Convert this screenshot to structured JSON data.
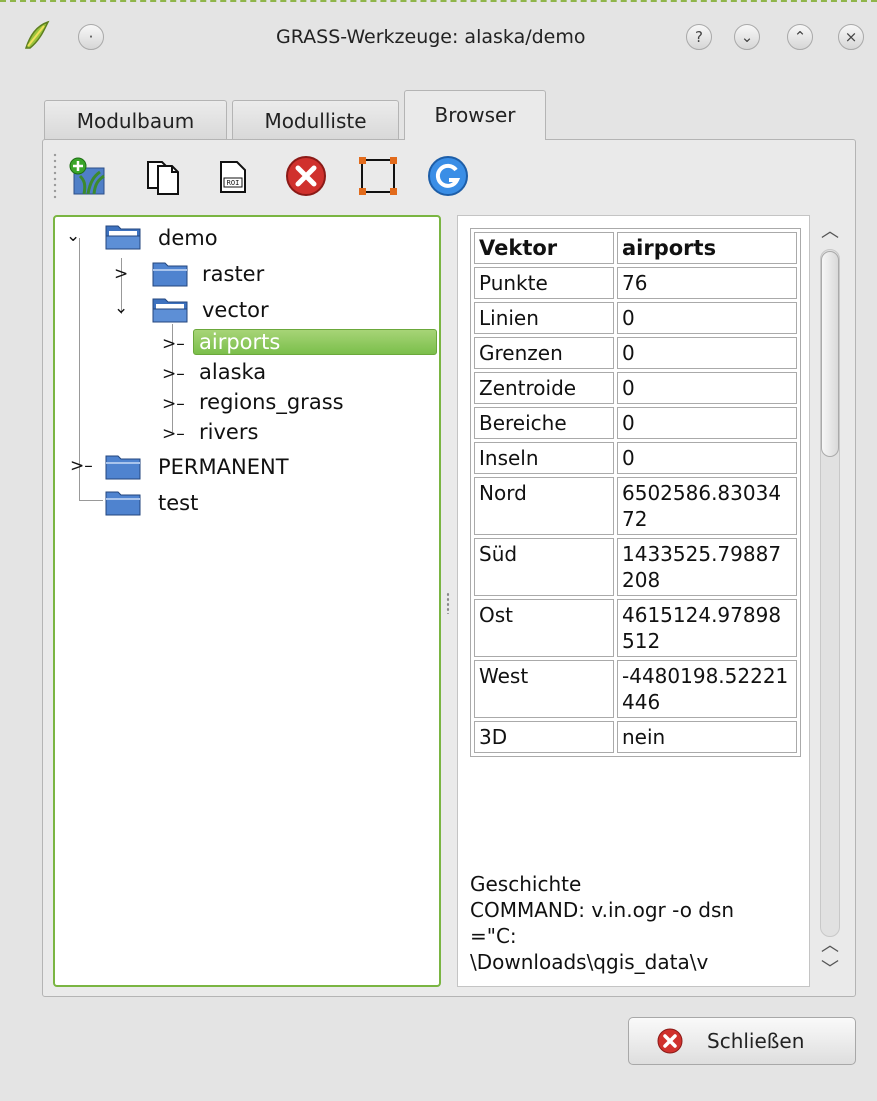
{
  "window": {
    "title": "GRASS-Werkzeuge: alaska/demo"
  },
  "titlebar_buttons": {
    "help": "?",
    "minimize": "⌄",
    "maximize": "⌃",
    "close": "×"
  },
  "tabs": [
    {
      "label": "Modulbaum",
      "active": false
    },
    {
      "label": "Modulliste",
      "active": false
    },
    {
      "label": "Browser",
      "active": true
    }
  ],
  "toolbar": {
    "icons": [
      "add-map-icon",
      "copy-icon",
      "rename-icon",
      "delete-icon",
      "set-region-icon",
      "refresh-icon"
    ]
  },
  "tree": {
    "items": [
      {
        "label": "demo",
        "level": 0,
        "expanded": true
      },
      {
        "label": "raster",
        "level": 1,
        "expanded": false
      },
      {
        "label": "vector",
        "level": 1,
        "expanded": true
      },
      {
        "label": "airports",
        "level": 2,
        "selected": true
      },
      {
        "label": "alaska",
        "level": 2
      },
      {
        "label": "regions_grass",
        "level": 2
      },
      {
        "label": "rivers",
        "level": 2
      },
      {
        "label": "PERMANENT",
        "level": 0,
        "expanded": false
      },
      {
        "label": "test",
        "level": 0
      }
    ]
  },
  "info": {
    "header": {
      "key": "Vektor",
      "value": "airports"
    },
    "rows": [
      {
        "key": "Punkte",
        "value": "76"
      },
      {
        "key": "Linien",
        "value": "0"
      },
      {
        "key": "Grenzen",
        "value": "0"
      },
      {
        "key": "Zentroide",
        "value": "0"
      },
      {
        "key": "Bereiche",
        "value": "0"
      },
      {
        "key": "Inseln",
        "value": "0"
      },
      {
        "key": "Nord",
        "value": "6502586.8303472"
      },
      {
        "key": "Süd",
        "value": "1433525.79887208"
      },
      {
        "key": "Ost",
        "value": "4615124.97898512"
      },
      {
        "key": "West",
        "value": "-4480198.52221446"
      },
      {
        "key": "3D",
        "value": "nein"
      }
    ],
    "history": "Geschichte\nCOMMAND: v.in.ogr -o dsn=\"C:\n\\Downloads\\qgis_data\\v"
  },
  "buttons": {
    "close": "Schließen"
  },
  "colors": {
    "selection": "#7bbf4b",
    "tree_border": "#7ab542",
    "close_icon": "#d0312d",
    "refresh_icon": "#3a8ee6"
  }
}
